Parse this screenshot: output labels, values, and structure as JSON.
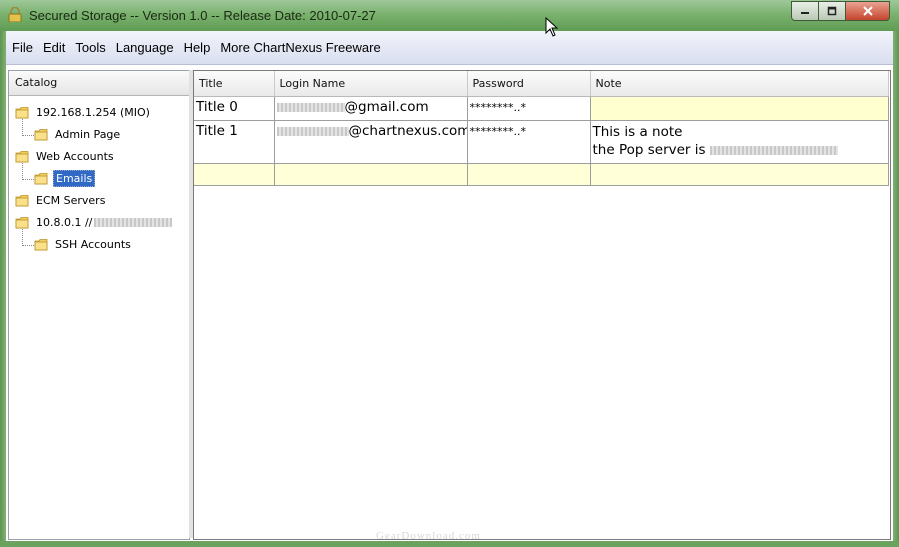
{
  "window": {
    "title": "Secured Storage -- Version 1.0 -- Release Date: 2010-07-27",
    "controls": [
      "minimize-icon",
      "maximize-icon",
      "close-icon"
    ]
  },
  "menubar": {
    "items": [
      "File",
      "Edit",
      "Tools",
      "Language",
      "Help",
      "More ChartNexus Freeware"
    ]
  },
  "catalog": {
    "header": "Catalog",
    "tree": [
      {
        "label": "192.168.1.254 (MIO)",
        "level": 0
      },
      {
        "label": "Admin Page",
        "level": 1
      },
      {
        "label": "Web Accounts",
        "level": 0
      },
      {
        "label": "Emails",
        "level": 1,
        "selected": true
      },
      {
        "label": "ECM Servers",
        "level": 0
      },
      {
        "label": "10.8.0.1 //",
        "level": 0
      },
      {
        "label": "SSH Accounts",
        "level": 1
      }
    ]
  },
  "table": {
    "columns": [
      "Title",
      "Login Name",
      "Password",
      "Note"
    ],
    "rows": [
      {
        "title": "Title 0",
        "login_suffix": "@gmail.com",
        "password": "********..*",
        "note_line1": "",
        "note_line2": ""
      },
      {
        "title": "Title 1",
        "login_suffix": "@chartnexus.com",
        "password": "********..*",
        "note_line1": "This is a note",
        "note_line2": "the Pop server is"
      }
    ]
  },
  "watermark": "GearDownload.com",
  "colors": {
    "titlebar": "#7bb26f",
    "menubar": "#e4e8f5",
    "selection": "#3169c6",
    "highlight_row": "#ffffd8"
  }
}
